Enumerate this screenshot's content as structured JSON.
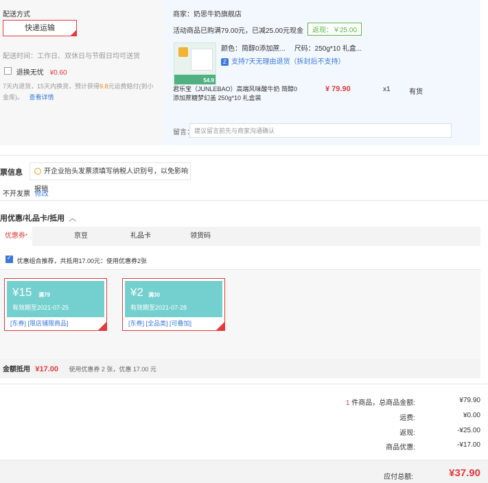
{
  "shipping": {
    "title": "配送方式",
    "method": "快递运输",
    "time_label": "配送时间：工作日、双休日与节假日均可送货",
    "insurance_label": "退换无忧",
    "insurance_price": "¥0.60",
    "insurance_desc_1": "7天内退货，15天内换货，预计获得",
    "insurance_highlight": "9.8",
    "insurance_desc_2": "元运费赔付(到小",
    "insurance_desc_3": "金库)。",
    "details_link": "查看详情"
  },
  "store": {
    "merchant": "商家：奶思牛奶旗舰店",
    "promo": "活动商品已购满79.00元，已减25.00元现金",
    "cashback_badge": "返现：￥25.00",
    "item": {
      "color_label": "颜色：简醇0添加蔗...",
      "size_label": "尺码：250g*10 礼盒...",
      "return_policy": "支持7天无理由退货（拆封后不支持）",
      "return_icon": "Z",
      "name_line1": "君乐宝（JUNLEBAO）高端风味酸牛奶 简醇0",
      "name_line2": "添加蔗糖梦幻盖 250g*10 礼盒装",
      "price": "¥ 79.90",
      "qty": "x1",
      "stock": "有货",
      "thumb_price": "54.9"
    },
    "note_label": "留言：",
    "note_placeholder": "建议留言前先与商家沟通确认"
  },
  "invoice": {
    "title": "票信息",
    "tip": "开企业抬头发票须填写纳税人识别号，以免影响报销",
    "status": "不开发票",
    "edit_link": "修改"
  },
  "discount": {
    "title": "用优惠/礼品卡/抵用",
    "tabs": [
      "优惠券",
      "京豆",
      "礼品卡",
      "领货码"
    ],
    "recommend": "优惠组合推荐，共抵用17.00元：使用优惠券2张",
    "coupons": [
      {
        "amount": "¥15",
        "cond": "满79",
        "expire": "有效期至2021-07-25",
        "tags": "[东券] [限店铺限商品]"
      },
      {
        "amount": "¥2",
        "cond": "满30",
        "expire": "有效期至2021-07-28",
        "tags": "[东券] [全品类] [可叠加]"
      }
    ],
    "summary_label": "金额抵用",
    "summary_amount": "¥17.00",
    "summary_desc": "使用优惠券 2 张，优惠 17.00 元"
  },
  "totals": {
    "count_num": "1",
    "count_label": " 件商品，总商品金额:",
    "goods_amount": "¥79.90",
    "freight_label": "运费:",
    "freight": "¥0.00",
    "cashback_label": "返现:",
    "cashback": "-¥25.00",
    "discount_label": "商品优惠:",
    "discount": "-¥17.00",
    "payable_label": "应付总额:",
    "payable": "¥37.90"
  },
  "colors": {
    "accent": "#e4393c",
    "link": "#3b78dd",
    "teal": "#74cfcf",
    "green": "#5fb447"
  }
}
